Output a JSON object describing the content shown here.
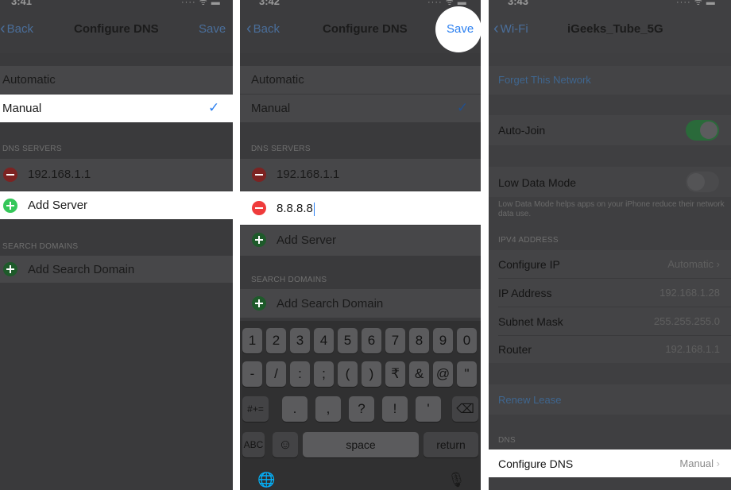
{
  "colors": {
    "link_blue": "#4a6e9a",
    "checkmark_blue": "#2a7ff0",
    "delete_red": "#ef3b3b",
    "add_green": "#35c759",
    "toggle_green": "#2a6a3a"
  },
  "screen1": {
    "status": {
      "time": "3:41",
      "icons": "···· ᯤ ▬"
    },
    "nav": {
      "back_label": "Back",
      "title": "Configure DNS",
      "save_label": "Save"
    },
    "modes": {
      "automatic": "Automatic",
      "manual": "Manual",
      "selected": "Manual"
    },
    "dns_header": "DNS SERVERS",
    "servers": [
      "192.168.1.1"
    ],
    "add_server": "Add Server",
    "search_header": "SEARCH DOMAINS",
    "add_search_domain": "Add Search Domain"
  },
  "screen2": {
    "status": {
      "time": "3:42",
      "icons": "···· ᯤ ▬"
    },
    "nav": {
      "back_label": "Back",
      "title": "Configure DNS",
      "save_label": "Save"
    },
    "modes": {
      "automatic": "Automatic",
      "manual": "Manual",
      "selected": "Manual"
    },
    "dns_header": "DNS SERVERS",
    "servers": [
      "192.168.1.1",
      "8.8.8.8"
    ],
    "add_server": "Add Server",
    "search_header": "SEARCH DOMAINS",
    "add_search_domain": "Add Search Domain",
    "keyboard": {
      "row1": [
        "1",
        "2",
        "3",
        "4",
        "5",
        "6",
        "7",
        "8",
        "9",
        "0"
      ],
      "row2": [
        "-",
        "/",
        ":",
        ";",
        "(",
        ")",
        "₹",
        "&",
        "@",
        "\""
      ],
      "row3_left": "#+=",
      "row3": [
        ".",
        ",",
        "?",
        "!",
        "'"
      ],
      "row3_right": "⌫",
      "abc": "ABC",
      "emoji": "☺",
      "space": "space",
      "return": "return",
      "globe": "🌐",
      "mic": "🎙"
    }
  },
  "screen3": {
    "status": {
      "time": "3:43",
      "icons": "···· ᯤ ▬"
    },
    "nav": {
      "back_label": "Wi-Fi",
      "title": "iGeeks_Tube_5G"
    },
    "forget": "Forget This Network",
    "auto_join": {
      "label": "Auto-Join",
      "on": true
    },
    "low_data": {
      "label": "Low Data Mode",
      "on": false,
      "footnote": "Low Data Mode helps apps on your iPhone reduce their network data use."
    },
    "ipv4_header": "IPV4 ADDRESS",
    "ipv4": [
      {
        "label": "Configure IP",
        "value": "Automatic"
      },
      {
        "label": "IP Address",
        "value": "192.168.1.28"
      },
      {
        "label": "Subnet Mask",
        "value": "255.255.255.0"
      },
      {
        "label": "Router",
        "value": "192.168.1.1"
      }
    ],
    "renew": "Renew Lease",
    "dns_header": "DNS",
    "configure_dns": {
      "label": "Configure DNS",
      "value": "Manual"
    }
  }
}
